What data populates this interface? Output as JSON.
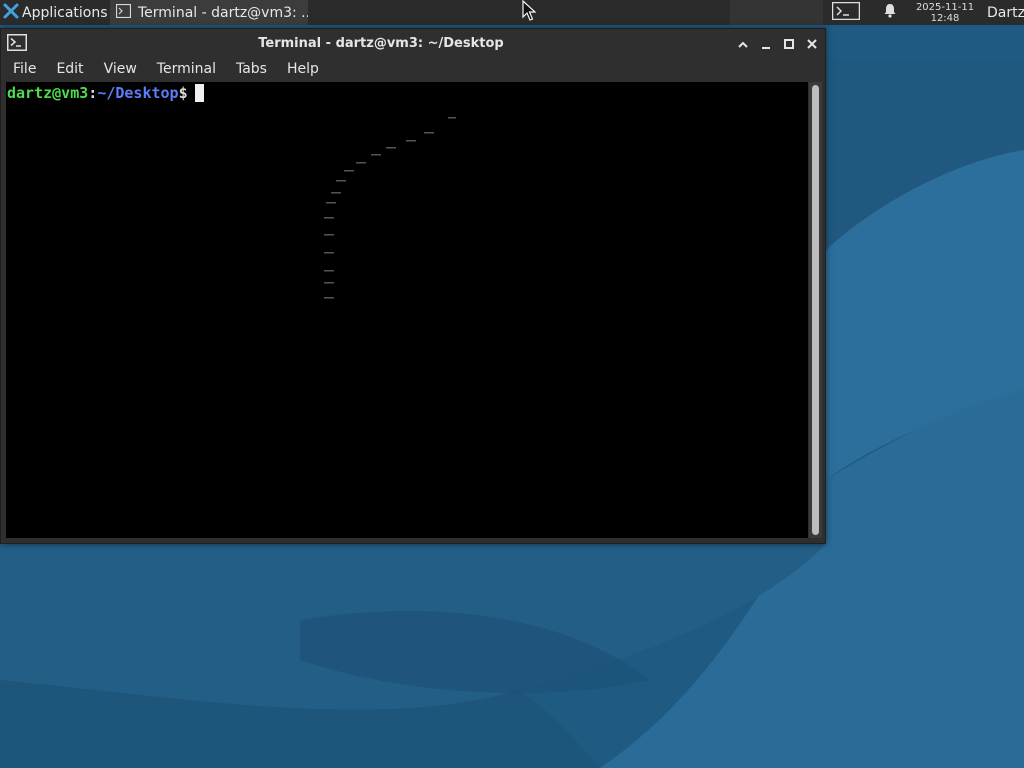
{
  "panel": {
    "applications_label": "Applications",
    "applications_sep": "≡",
    "taskbar_title": "Terminal - dartz@vm3: ...",
    "clock_date": "2025-11-11",
    "clock_time": "12:48",
    "user_name": "Dartz",
    "panel_color": "#2b2b2b"
  },
  "window": {
    "title": "Terminal - dartz@vm3: ~/Desktop",
    "menu": [
      "File",
      "Edit",
      "View",
      "Terminal",
      "Tabs",
      "Help"
    ]
  },
  "terminal": {
    "prompt_user": "dartz@vm3",
    "prompt_colon": ":",
    "prompt_path": "~/Desktop",
    "prompt_symbol": "$",
    "user_color": "#4edb4e",
    "path_color": "#5c7cfa",
    "background": "#000000"
  },
  "icons": {
    "applications": "xfce-logo-icon",
    "taskbar": "terminal-icon",
    "tray": "terminal-icon",
    "notifications": "bell-icon",
    "window_controls": [
      "chevron-up-icon",
      "minimize-icon",
      "maximize-icon",
      "close-icon"
    ]
  },
  "desktop": {
    "colors": [
      "#245f88",
      "#1c4f73",
      "#2a6e9c"
    ]
  }
}
